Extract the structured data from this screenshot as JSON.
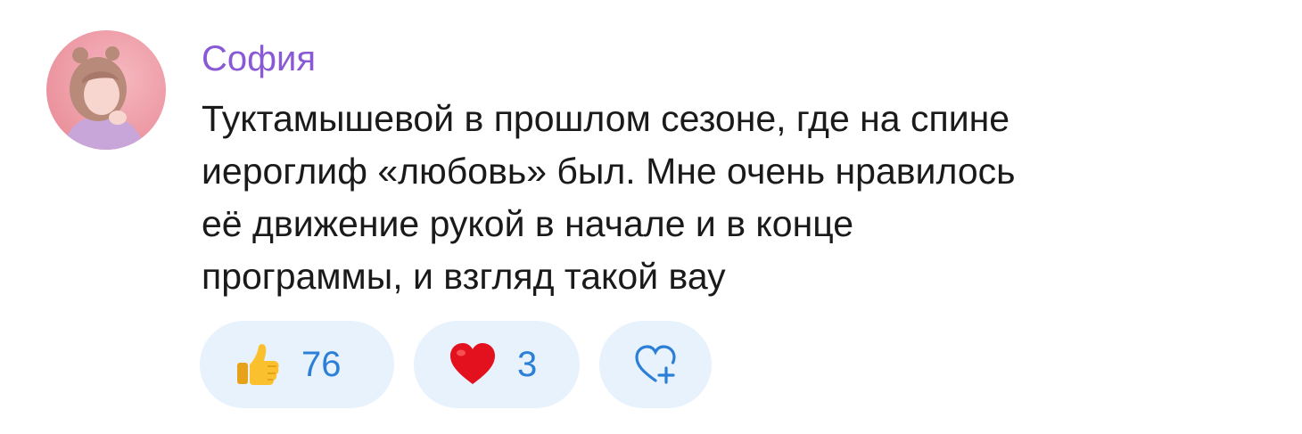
{
  "comment": {
    "author": "София",
    "author_color": "#8a5ad6",
    "text_lines": [
      "Туктамышевой в прошлом сезоне, где на спине",
      "иероглиф «любовь» был. Мне очень нравилось",
      "её движение рукой в начале и в конце",
      "программы, и взгляд такой вау"
    ]
  },
  "reactions": [
    {
      "icon": "thumbs-up-icon",
      "count": "76"
    },
    {
      "icon": "heart-icon",
      "count": "3"
    },
    {
      "icon": "add-reaction-icon"
    }
  ],
  "colors": {
    "pill_background": "#e8f2fc",
    "count_text": "#2b7fd6"
  }
}
